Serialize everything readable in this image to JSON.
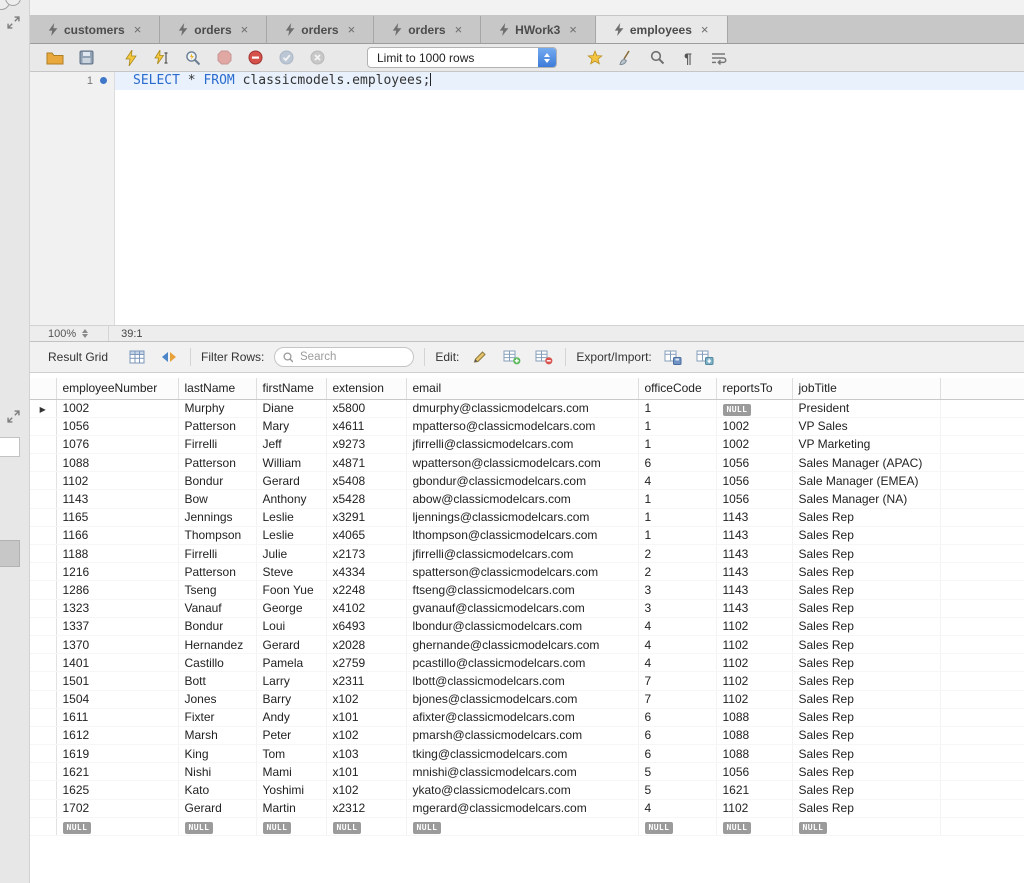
{
  "tabs": {
    "close_glyph": "×",
    "items": [
      {
        "label": "customers",
        "active": false
      },
      {
        "label": "orders",
        "active": false
      },
      {
        "label": "orders",
        "active": false
      },
      {
        "label": "orders",
        "active": false
      },
      {
        "label": "HWork3",
        "active": false
      },
      {
        "label": "employees",
        "active": true
      }
    ]
  },
  "toolbar": {
    "limit_dropdown": "Limit to 1000 rows",
    "pilcrow_glyph": "¶",
    "icons": [
      "open-script",
      "save-script",
      "execute",
      "execute-current-statement",
      "explain",
      "stop",
      "toggle-stop-on-error",
      "commit",
      "rollback",
      "beautify",
      "clean",
      "find",
      "invisible-characters",
      "wrap-text"
    ]
  },
  "editor": {
    "line_number": "1",
    "kw_select": "SELECT",
    "mid": " * ",
    "kw_from": "FROM",
    "tail": " classicmodels.employees;"
  },
  "status": {
    "zoom": "100%",
    "cursor_position": "39:1"
  },
  "result_toolbar": {
    "title": "Result Grid",
    "filter_label": "Filter Rows:",
    "search_placeholder": "Search",
    "edit_label": "Edit:",
    "export_label": "Export/Import:"
  },
  "grid": {
    "row_marker": "▶",
    "null_token": "NULL",
    "columns": [
      "employeeNumber",
      "lastName",
      "firstName",
      "extension",
      "email",
      "officeCode",
      "reportsTo",
      "jobTitle"
    ],
    "rows": [
      [
        "1002",
        "Murphy",
        "Diane",
        "x5800",
        "dmurphy@classicmodelcars.com",
        "1",
        "NULL",
        "President"
      ],
      [
        "1056",
        "Patterson",
        "Mary",
        "x4611",
        "mpatterso@classicmodelcars.com",
        "1",
        "1002",
        "VP Sales"
      ],
      [
        "1076",
        "Firrelli",
        "Jeff",
        "x9273",
        "jfirrelli@classicmodelcars.com",
        "1",
        "1002",
        "VP Marketing"
      ],
      [
        "1088",
        "Patterson",
        "William",
        "x4871",
        "wpatterson@classicmodelcars.com",
        "6",
        "1056",
        "Sales Manager (APAC)"
      ],
      [
        "1102",
        "Bondur",
        "Gerard",
        "x5408",
        "gbondur@classicmodelcars.com",
        "4",
        "1056",
        "Sale Manager (EMEA)"
      ],
      [
        "1143",
        "Bow",
        "Anthony",
        "x5428",
        "abow@classicmodelcars.com",
        "1",
        "1056",
        "Sales Manager (NA)"
      ],
      [
        "1165",
        "Jennings",
        "Leslie",
        "x3291",
        "ljennings@classicmodelcars.com",
        "1",
        "1143",
        "Sales Rep"
      ],
      [
        "1166",
        "Thompson",
        "Leslie",
        "x4065",
        "lthompson@classicmodelcars.com",
        "1",
        "1143",
        "Sales Rep"
      ],
      [
        "1188",
        "Firrelli",
        "Julie",
        "x2173",
        "jfirrelli@classicmodelcars.com",
        "2",
        "1143",
        "Sales Rep"
      ],
      [
        "1216",
        "Patterson",
        "Steve",
        "x4334",
        "spatterson@classicmodelcars.com",
        "2",
        "1143",
        "Sales Rep"
      ],
      [
        "1286",
        "Tseng",
        "Foon Yue",
        "x2248",
        "ftseng@classicmodelcars.com",
        "3",
        "1143",
        "Sales Rep"
      ],
      [
        "1323",
        "Vanauf",
        "George",
        "x4102",
        "gvanauf@classicmodelcars.com",
        "3",
        "1143",
        "Sales Rep"
      ],
      [
        "1337",
        "Bondur",
        "Loui",
        "x6493",
        "lbondur@classicmodelcars.com",
        "4",
        "1102",
        "Sales Rep"
      ],
      [
        "1370",
        "Hernandez",
        "Gerard",
        "x2028",
        "ghernande@classicmodelcars.com",
        "4",
        "1102",
        "Sales Rep"
      ],
      [
        "1401",
        "Castillo",
        "Pamela",
        "x2759",
        "pcastillo@classicmodelcars.com",
        "4",
        "1102",
        "Sales Rep"
      ],
      [
        "1501",
        "Bott",
        "Larry",
        "x2311",
        "lbott@classicmodelcars.com",
        "7",
        "1102",
        "Sales Rep"
      ],
      [
        "1504",
        "Jones",
        "Barry",
        "x102",
        "bjones@classicmodelcars.com",
        "7",
        "1102",
        "Sales Rep"
      ],
      [
        "1611",
        "Fixter",
        "Andy",
        "x101",
        "afixter@classicmodelcars.com",
        "6",
        "1088",
        "Sales Rep"
      ],
      [
        "1612",
        "Marsh",
        "Peter",
        "x102",
        "pmarsh@classicmodelcars.com",
        "6",
        "1088",
        "Sales Rep"
      ],
      [
        "1619",
        "King",
        "Tom",
        "x103",
        "tking@classicmodelcars.com",
        "6",
        "1088",
        "Sales Rep"
      ],
      [
        "1621",
        "Nishi",
        "Mami",
        "x101",
        "mnishi@classicmodelcars.com",
        "5",
        "1056",
        "Sales Rep"
      ],
      [
        "1625",
        "Kato",
        "Yoshimi",
        "x102",
        "ykato@classicmodelcars.com",
        "5",
        "1621",
        "Sales Rep"
      ],
      [
        "1702",
        "Gerard",
        "Martin",
        "x2312",
        "mgerard@classicmodelcars.com",
        "4",
        "1102",
        "Sales Rep"
      ],
      [
        "NULL",
        "NULL",
        "NULL",
        "NULL",
        "NULL",
        "NULL",
        "NULL",
        "NULL"
      ]
    ]
  }
}
